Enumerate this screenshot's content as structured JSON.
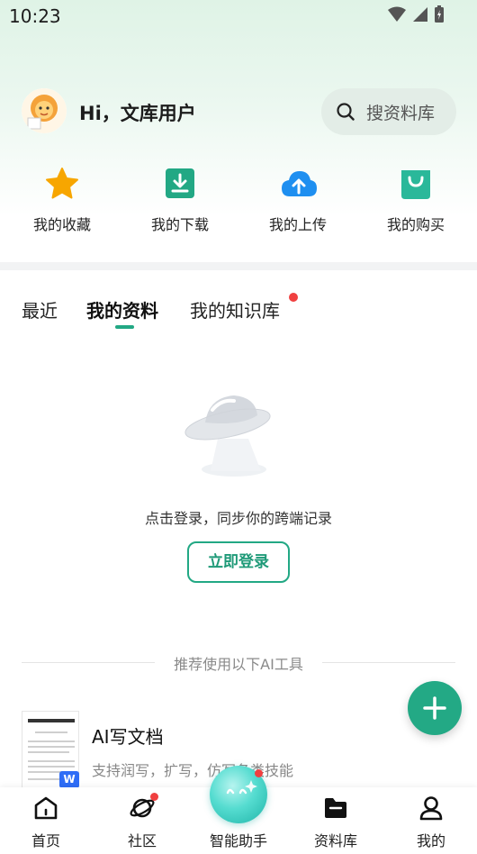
{
  "status_bar": {
    "time": "10:23"
  },
  "header": {
    "greeting": "Hi，文库用户"
  },
  "search": {
    "placeholder": "搜资料库"
  },
  "quick_actions": [
    {
      "label": "我的收藏",
      "icon": "star-icon",
      "color": "#f7a600"
    },
    {
      "label": "我的下载",
      "icon": "download-icon",
      "color": "#22a884"
    },
    {
      "label": "我的上传",
      "icon": "upload-cloud-icon",
      "color": "#1e8ff0"
    },
    {
      "label": "我的购买",
      "icon": "shopping-bag-icon",
      "color": "#2ab89a"
    }
  ],
  "tabs": [
    {
      "label": "最近",
      "active": false
    },
    {
      "label": "我的资料",
      "active": true
    },
    {
      "label": "我的知识库",
      "active": false,
      "dot": true
    }
  ],
  "empty_state": {
    "message": "点击登录，同步你的跨端记录",
    "button_label": "立即登录"
  },
  "recommend": {
    "title": "推荐使用以下AI工具"
  },
  "ai_tool": {
    "title": "AI写文档",
    "subtitle": "支持润写，扩写，仿写各类技能",
    "badge": "W"
  },
  "bottom_nav": [
    {
      "label": "首页",
      "icon": "home-icon"
    },
    {
      "label": "社区",
      "icon": "planet-icon",
      "dot": true
    },
    {
      "label": "智能助手",
      "icon": "assistant-orb-icon",
      "dot": true
    },
    {
      "label": "资料库",
      "icon": "folder-icon"
    },
    {
      "label": "我的",
      "icon": "profile-icon"
    }
  ],
  "colors": {
    "accent": "#22a884",
    "badge_red": "#f04040",
    "fab": "#23a985"
  }
}
